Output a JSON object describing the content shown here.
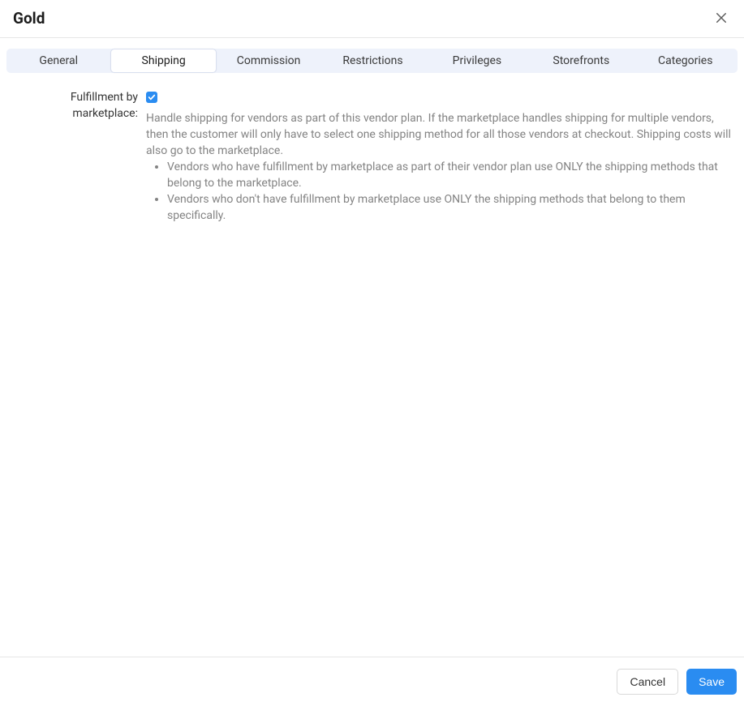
{
  "header": {
    "title": "Gold"
  },
  "tabs": [
    {
      "label": "General",
      "active": false
    },
    {
      "label": "Shipping",
      "active": true
    },
    {
      "label": "Commission",
      "active": false
    },
    {
      "label": "Restrictions",
      "active": false
    },
    {
      "label": "Privileges",
      "active": false
    },
    {
      "label": "Storefronts",
      "active": false
    },
    {
      "label": "Categories",
      "active": false
    }
  ],
  "form": {
    "fulfillment_label": "Fulfillment by marketplace:",
    "fulfillment_checked": true,
    "fulfillment_description": "Handle shipping for vendors as part of this vendor plan. If the marketplace handles shipping for multiple vendors, then the customer will only have to select one shipping method for all those vendors at checkout. Shipping costs will also go to the marketplace.",
    "fulfillment_bullets": [
      "Vendors who have fulfillment by marketplace as part of their vendor plan use ONLY the shipping methods that belong to the marketplace.",
      "Vendors who don't have fulfillment by marketplace use ONLY the shipping methods that belong to them specifically."
    ]
  },
  "footer": {
    "cancel_label": "Cancel",
    "save_label": "Save"
  }
}
